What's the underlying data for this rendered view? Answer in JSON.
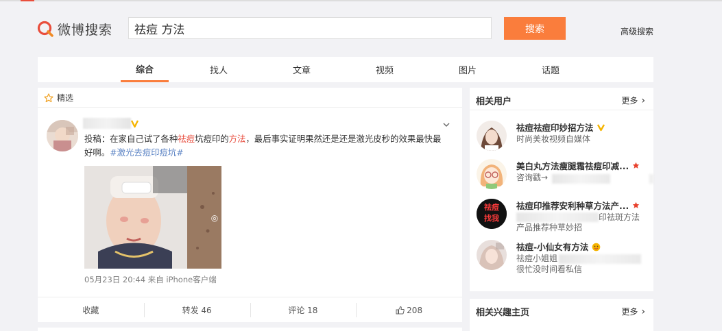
{
  "brand": {
    "logo_text": "微博搜索"
  },
  "search": {
    "query": "祛痘 方法",
    "button": "搜索",
    "advanced": "高级搜索"
  },
  "tabs": [
    {
      "label": "综合",
      "active": true
    },
    {
      "label": "找人"
    },
    {
      "label": "文章"
    },
    {
      "label": "视频"
    },
    {
      "label": "图片"
    },
    {
      "label": "话题"
    }
  ],
  "featured": {
    "section_label": "精选",
    "post": {
      "text_prefix": "投稿：在家自己试了各种",
      "text_hl1": "祛痘",
      "text_mid": "坑痘印的",
      "text_hl2": "方法",
      "text_suffix": "，最后事实证明果然还是还是激光皮秒的效果最快最好啊。",
      "hashtag": "#激光去痘印痘坑#",
      "meta": "05月23日 20:44  来自 iPhone客户端"
    },
    "actions": {
      "favorite": "收藏",
      "repost": "转发 46",
      "comment": "评论 18",
      "like": "208"
    }
  },
  "related_users": {
    "title": "相关用户",
    "more": "更多",
    "users": [
      {
        "name": "祛痘祛痘印妙招方法",
        "desc": "时尚美妆视频自媒体"
      },
      {
        "name": "美白丸方法瘦腿霜祛痘印减...",
        "desc": "咨询戳→"
      },
      {
        "name": "祛痘印推荐安利种草方法产...",
        "desc": "印祛斑方法",
        "desc2": "产品推荐种草妙招",
        "avatar_text1": "祛痘",
        "avatar_text2": "找我"
      },
      {
        "name": "祛痘-小仙女有方法",
        "desc": "祛痘小姐姐",
        "desc2": "很忙没时间看私信"
      }
    ]
  },
  "related_interest": {
    "title": "相关兴趣主页",
    "more": "更多"
  },
  "colors": {
    "accent": "#fa7d3c",
    "highlight": "#e84c3d",
    "link": "#5b83c4",
    "verified": "#f5b400"
  }
}
